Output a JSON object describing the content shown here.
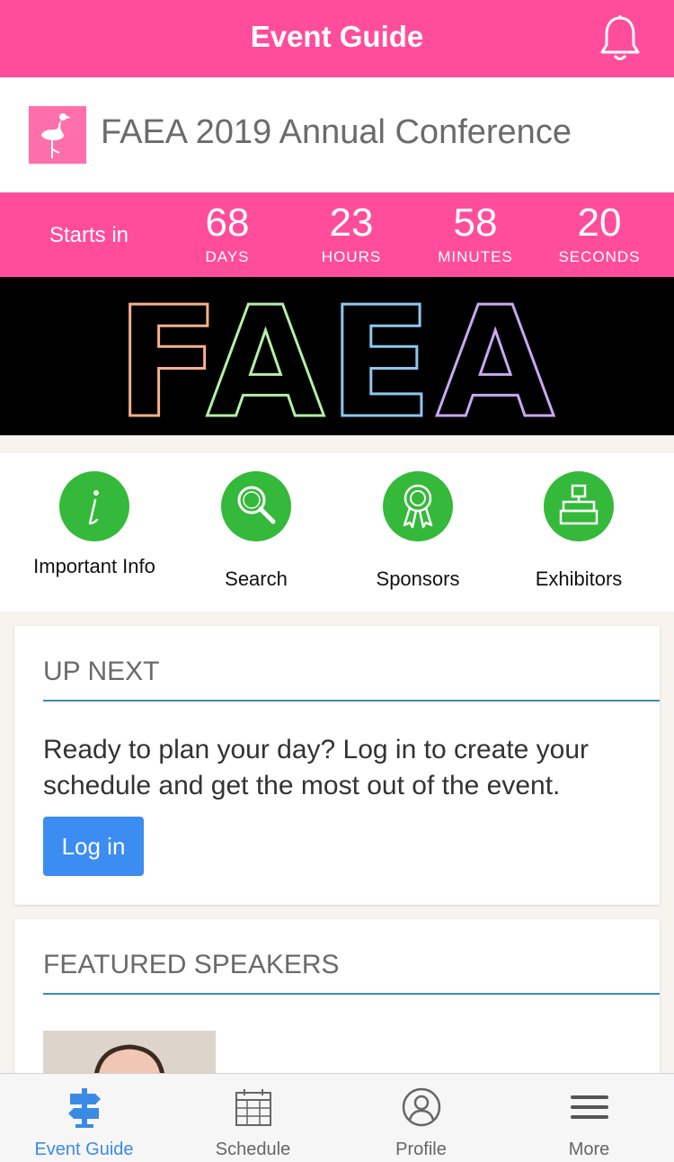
{
  "header": {
    "title": "Event Guide",
    "notification_icon": "bell-icon"
  },
  "conference": {
    "title": "FAEA 2019 Annual Conference",
    "logo_icon": "flamingo-logo"
  },
  "countdown": {
    "starts_label": "Starts in",
    "units": [
      {
        "value": "68",
        "label": "DAYS"
      },
      {
        "value": "23",
        "label": "HOURS"
      },
      {
        "value": "58",
        "label": "MINUTES"
      },
      {
        "value": "20",
        "label": "SECONDS"
      }
    ]
  },
  "banner": {
    "text": "FAEA",
    "letter_colors": [
      "#f7b08a",
      "#b4f0a6",
      "#8cc8ee",
      "#c9a8f0"
    ]
  },
  "shortcuts": [
    {
      "label": "Important Info",
      "icon": "info-icon"
    },
    {
      "label": "Search",
      "icon": "search-icon"
    },
    {
      "label": "Sponsors",
      "icon": "ribbon-icon"
    },
    {
      "label": "Exhibitors",
      "icon": "booth-icon"
    }
  ],
  "up_next": {
    "title": "UP NEXT",
    "message": "Ready to plan your day? Log in to create your schedule and get the most out of the event.",
    "login_label": "Log in"
  },
  "featured_speakers": {
    "title": "FEATURED SPEAKERS"
  },
  "tabbar": {
    "tabs": [
      {
        "label": "Event Guide",
        "icon": "signpost-icon",
        "active": true
      },
      {
        "label": "Schedule",
        "icon": "calendar-icon",
        "active": false
      },
      {
        "label": "Profile",
        "icon": "profile-icon",
        "active": false
      },
      {
        "label": "More",
        "icon": "hamburger-menu-icon",
        "active": false
      }
    ]
  },
  "colors": {
    "brand_pink": "#ff4d9c",
    "shortcut_green": "#34b93a",
    "button_blue": "#3b8df2",
    "active_tab_blue": "#3b8ae6",
    "rule_blue": "#3a8ac0"
  }
}
